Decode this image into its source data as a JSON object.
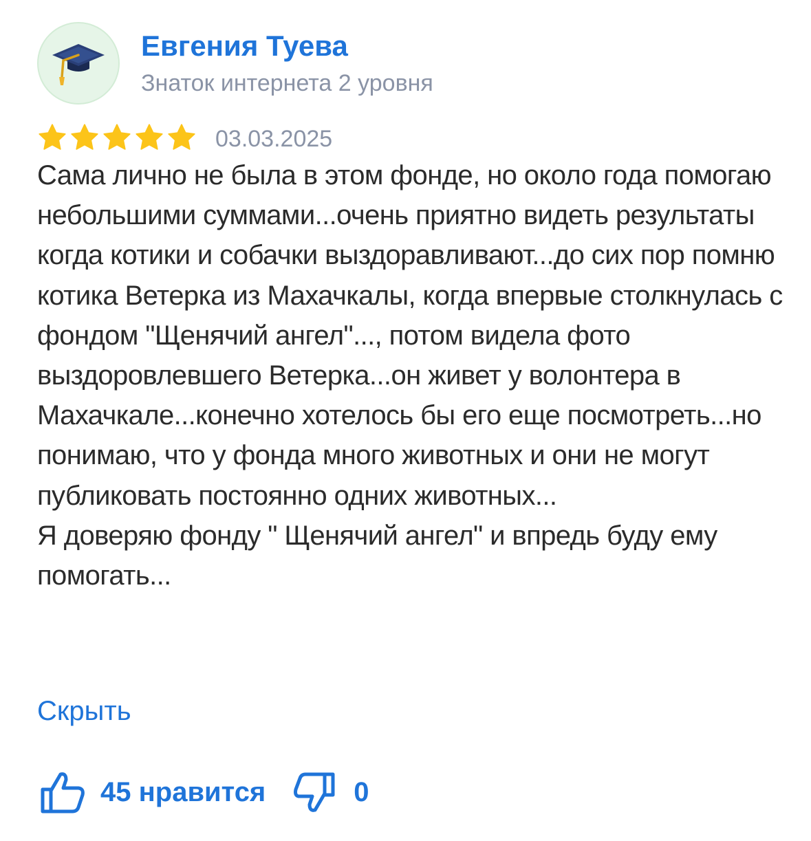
{
  "author": {
    "name": "Евгения Туева",
    "level": "Знаток интернета 2 уровня",
    "avatar_icon": "graduation-cap-icon"
  },
  "review": {
    "rating": 5,
    "rating_max": 5,
    "date": "03.03.2025",
    "text": "Сама лично не была в этом фонде, но около года помогаю небольшими суммами...очень приятно видеть результаты когда котики и собачки выздоравливают...до сих пор помню котика Ветерка из Махачкалы, когда впервые столкнулась с фондом \"Щенячий ангел\"..., потом видела фото выздоровлевшего Ветерка...он живет у волонтера в Махачкале...конечно хотелось бы его еще посмотреть...но понимаю, что у фонда много животных и они не могут публиковать постоянно одних животных...\nЯ доверяю фонду \" Щенячий ангел\" и впредь буду ему помогать...",
    "hide_label": "Скрыть"
  },
  "reactions": {
    "like_label": "45 нравится",
    "dislike_label": "0",
    "like_icon": "thumbs-up-icon",
    "dislike_icon": "thumbs-down-icon"
  },
  "colors": {
    "accent": "#1f74d9",
    "star": "#fcc419",
    "muted": "#8a93a6",
    "text": "#2b2b2b",
    "avatar_bg": "#e6f5e8"
  }
}
